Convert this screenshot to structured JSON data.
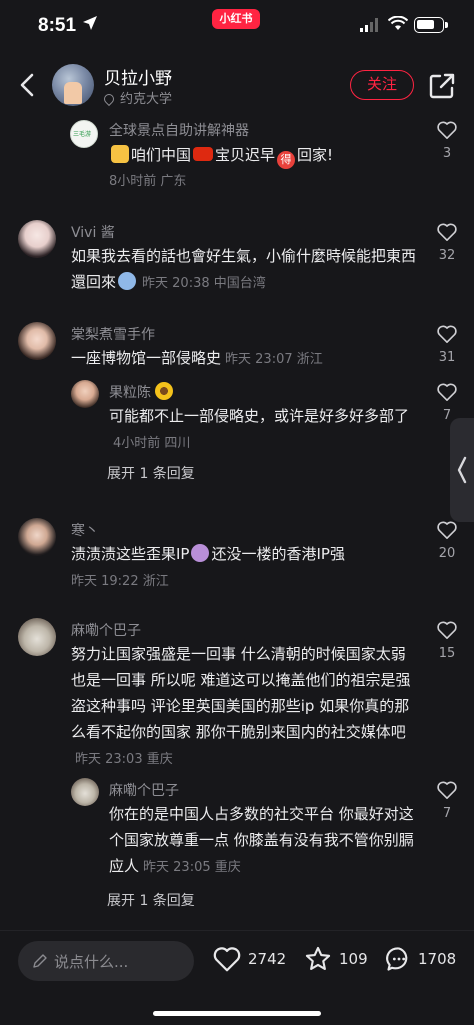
{
  "status_bar": {
    "time": "8:51",
    "app_badge": "小红书"
  },
  "header": {
    "username": "贝拉小野",
    "location": "约克大学",
    "follow_label": "关注"
  },
  "comments": [
    {
      "nick": "全球景点自助讲解神器",
      "avatar_label": "三毛游",
      "text_a": "咱们中国",
      "text_b": "宝贝迟早",
      "text_c": "回家!",
      "meta": "8小时前 广东",
      "likes": "3"
    },
    {
      "nick": "Vivi 酱",
      "text": "如果我去看的話也會好生氣，小偷什麼時候能把東西還回來",
      "meta": "昨天 20:38 中国台湾",
      "likes": "32"
    },
    {
      "nick": "棠梨煮雪手作",
      "text": "一座博物馆一部侵略史",
      "meta": "昨天 23:07 浙江",
      "likes": "31",
      "reply": {
        "nick": "果粒陈",
        "text": "可能都不止一部侵略史，或许是好多好多部了",
        "meta": "4小时前 四川",
        "likes": "7"
      },
      "expand": "展开 1 条回复"
    },
    {
      "nick": "寒丶",
      "text_a": "渍渍渍这些歪果IP",
      "text_b": "还没一楼的香港IP强",
      "meta": "昨天 19:22 浙江",
      "likes": "20"
    },
    {
      "nick": "麻嘞个巴子",
      "text": "努力让国家强盛是一回事 什么清朝的时候国家太弱也是一回事 所以呢 难道这可以掩盖他们的祖宗是强盗这种事吗 评论里英国美国的那些ip 如果你真的那么看不起你的国家 那你干脆别来国内的社交媒体吧",
      "meta": "昨天 23:03 重庆",
      "likes": "15",
      "reply": {
        "nick": "麻嘞个巴子",
        "text": "你在的是中国人占多数的社交平台 你最好对这个国家放尊重一点 你膝盖有没有我不管你别膈应人",
        "meta": "昨天 23:05 重庆",
        "likes": "7"
      },
      "expand": "展开 1 条回复"
    }
  ],
  "bottom_bar": {
    "input_placeholder": "说点什么...",
    "likes": "2742",
    "collects": "109",
    "comments": "1708"
  },
  "colors": {
    "brand": "#ff2442",
    "bg": "#17171a"
  },
  "icons": [
    "back-icon",
    "share-icon",
    "heart-icon",
    "star-icon",
    "comment-icon",
    "pencil-icon",
    "location-pin-icon"
  ]
}
